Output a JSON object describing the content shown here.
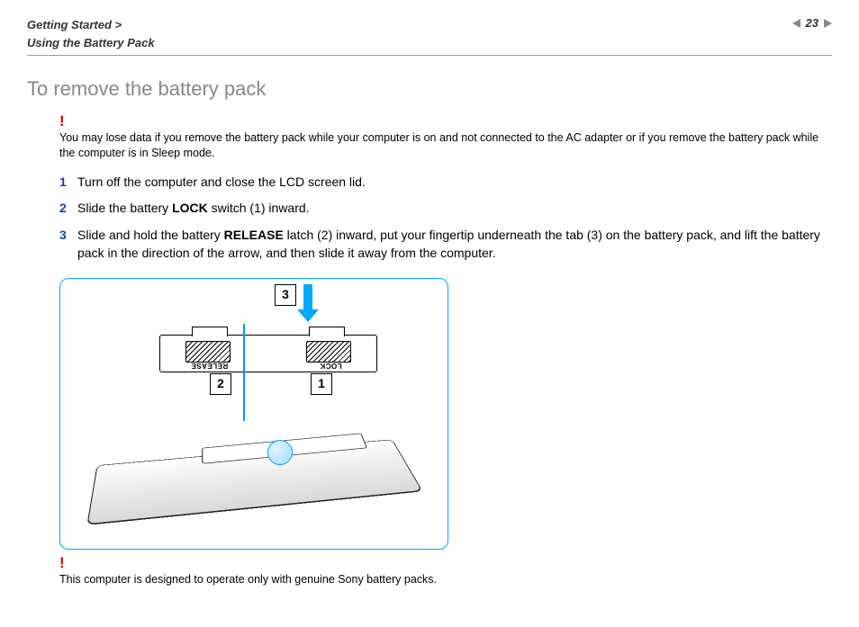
{
  "header": {
    "breadcrumb_line1": "Getting Started >",
    "breadcrumb_line2": "Using the Battery Pack",
    "page_number": "23"
  },
  "title": "To remove the battery pack",
  "warning1": "You may lose data if you remove the battery pack while your computer is on and not connected to the AC adapter or if you remove the battery pack while the computer is in Sleep mode.",
  "steps": [
    {
      "num": "1",
      "text": "Turn off the computer and close the LCD screen lid."
    },
    {
      "num": "2",
      "pre": "Slide the battery ",
      "bold": "LOCK",
      "post": " switch (1) inward."
    },
    {
      "num": "3",
      "pre": "Slide and hold the battery ",
      "bold": "RELEASE",
      "post": " latch (2) inward, put your fingertip underneath the tab (3) on the battery pack, and lift the battery pack in the direction of the arrow, and then slide it away from the computer."
    }
  ],
  "illustration": {
    "callout3": "3",
    "callout2": "2",
    "callout1": "1",
    "label_release": "RELEASE",
    "label_lock": "LOCK"
  },
  "warning2": "This computer is designed to operate only with genuine Sony battery packs."
}
